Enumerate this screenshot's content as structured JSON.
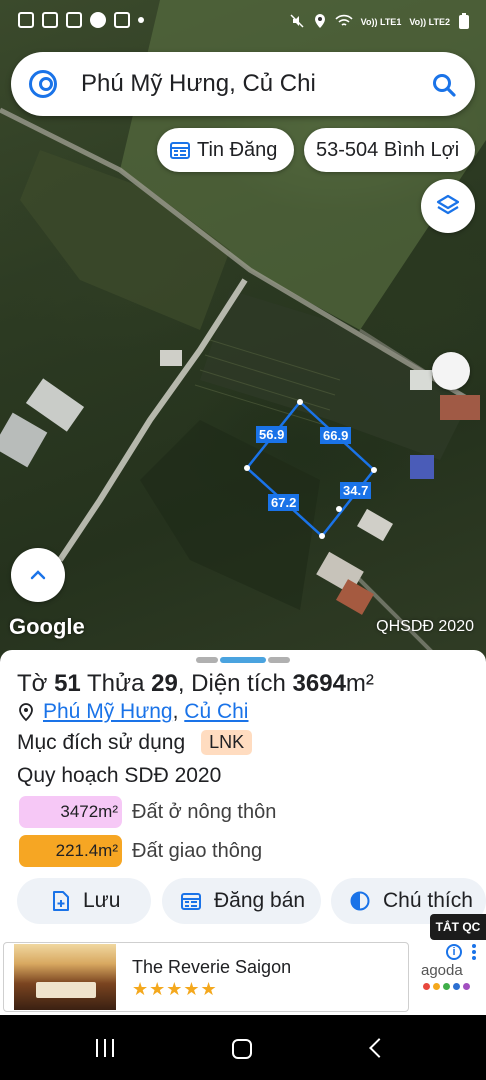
{
  "status_bar": {
    "lte1_label": "Vo)) LTE1",
    "lte2_label": "Vo)) LTE2"
  },
  "search": {
    "query": "Phú Mỹ Hưng, Củ Chi"
  },
  "chips": {
    "tin_dang": "Tin Đăng",
    "lot_code": "53-504 Bình Lợi"
  },
  "map": {
    "attribution": "Google",
    "layer_label": "QHSDĐ 2020",
    "edge_labels": [
      "56.9",
      "66.9",
      "67.2",
      "34.7"
    ],
    "polygon_color": "#1a73e8"
  },
  "parcel": {
    "to_prefix": "Tờ",
    "to_number": "51",
    "thua_prefix": "Thửa",
    "thua_number": "29",
    "area_prefix": ", Diện tích",
    "area_value": "3694",
    "area_unit": "m²",
    "ward": "Phú Mỹ Hưng",
    "district": "Củ Chi",
    "purpose_label": "Mục đích sử dụng",
    "purpose_code": "LNK",
    "plan_title": "Quy hoạch SDĐ 2020",
    "plan_items": [
      {
        "area": "3472m²",
        "label": "Đất ở nông thôn",
        "color": "#f6c8f6"
      },
      {
        "area": "221.4m²",
        "label": "Đất giao thông",
        "color": "#f6a623"
      }
    ]
  },
  "actions": {
    "save": "Lưu",
    "post_sale": "Đăng bán",
    "legend": "Chú thích"
  },
  "ad": {
    "tag": "TẮT QC",
    "title": "The Reverie Saigon",
    "stars": "★★★★★",
    "brand": "agoda",
    "brand_dot_colors": [
      "#e8473d",
      "#f4a81d",
      "#3fae49",
      "#2c6fd1",
      "#a24fc0"
    ]
  }
}
